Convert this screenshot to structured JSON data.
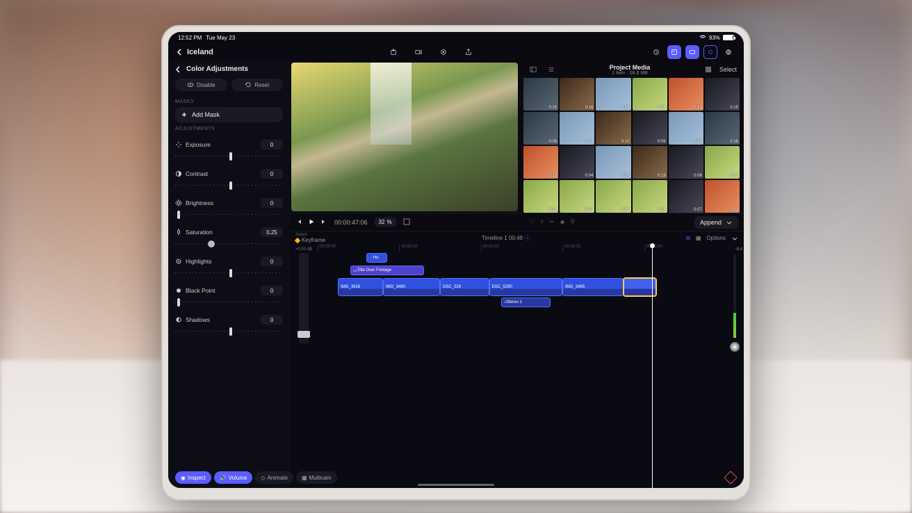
{
  "status": {
    "time": "12:52 PM",
    "date": "Tue May 23",
    "battery_pct": "93%"
  },
  "nav": {
    "project_title": "Iceland"
  },
  "inspector": {
    "title": "Color Adjustments",
    "disable": "Disable",
    "reset": "Reset",
    "masks_label": "MASKS",
    "add_mask": "Add Mask",
    "adjustments_label": "ADJUSTMENTS",
    "exposure": {
      "label": "Exposure",
      "value": "0",
      "pos": 50
    },
    "contrast": {
      "label": "Contrast",
      "value": "0",
      "pos": 50
    },
    "brightness": {
      "label": "Brightness",
      "value": "0",
      "pos": 2
    },
    "saturation": {
      "label": "Saturation",
      "value": "0.25",
      "pos": 30
    },
    "highlights": {
      "label": "Highlights",
      "value": "0",
      "pos": 50
    },
    "blackpoint": {
      "label": "Black Point",
      "value": "0",
      "pos": 2
    },
    "shadows": {
      "label": "Shadows",
      "value": "0",
      "pos": 50
    }
  },
  "media": {
    "title": "Project Media",
    "subtitle": "1 Item · 58.6 MB",
    "select": "Select",
    "durations": [
      "0:25",
      "0:16",
      "0:19",
      "0:24",
      "0:21",
      "0:15",
      "0:09",
      "0:07",
      "0:10",
      "0:09",
      "0:15",
      "0:16",
      "0:13",
      "0:04",
      "0:10",
      "0:19",
      "0:08",
      "0:13",
      "0:12",
      "0:07",
      "0:08",
      "0:14",
      "0:07",
      "1:22"
    ]
  },
  "transport": {
    "timecode": "00:00:47:06",
    "zoom_value": "32",
    "zoom_unit": "%",
    "append": "Append"
  },
  "timeline_header": {
    "select_label": "Select",
    "keyframe": "Keyframe",
    "name": "Timeline 1",
    "duration": "00:49",
    "options": "Options"
  },
  "timeline": {
    "vol_label": "+0.00 dB",
    "meter": "-8.4",
    "ruler": [
      "00:00:00",
      "00:00:10",
      "00:00:20",
      "00:00:30",
      "00:00:40"
    ],
    "ho_label": "Ho",
    "title_clip": "Title Over Footage",
    "clips": [
      "IMG_3616",
      "IMG_3490",
      "DSC_529",
      "DSC_5290",
      "IMG_3485"
    ],
    "audio": "Stereo 1"
  },
  "tabs": {
    "inspect": "Inspect",
    "volume": "Volume",
    "animate": "Animate",
    "multicam": "Multicam"
  }
}
